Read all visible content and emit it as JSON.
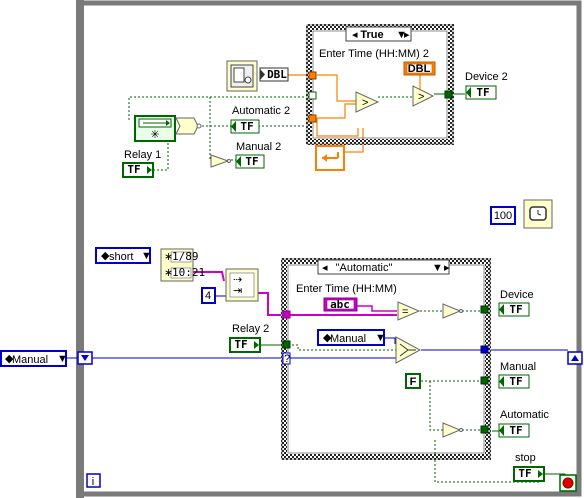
{
  "loop": {
    "info_icon": "i",
    "left_tunnel_control": {
      "value": "Manual",
      "icon": "enum-dropdown-icon"
    }
  },
  "top_case": {
    "selector": "True",
    "local_label": "Enter Time (HH:MM) 2",
    "dbl_constant": "DBL",
    "to_dbl_label": "DBL",
    "output_indicator": {
      "label": "Device 2",
      "tf": "TF"
    }
  },
  "left_top": {
    "relay1": {
      "label": "Relay 1",
      "tf": "TF"
    },
    "automatic2": {
      "label": "Automatic 2",
      "tf": "TF"
    },
    "manual2": {
      "label": "Manual 2",
      "tf": "TF"
    }
  },
  "wait": {
    "ms_constant": "100"
  },
  "lower_left": {
    "format_enum": "short",
    "time_fmt_lines": [
      "1/89",
      "10:21"
    ],
    "numeric_const": "4"
  },
  "bottom_case": {
    "selector": "\"Automatic\"",
    "local_label": "Enter Time (HH:MM)",
    "abc_constant": "abc",
    "relay2": {
      "label": "Relay 2",
      "tf": "TF"
    },
    "enum_const": "Manual",
    "false_const": "F",
    "device": {
      "label": "Device",
      "tf": "TF"
    },
    "manual": {
      "label": "Manual",
      "tf": "TF"
    },
    "automatic": {
      "label": "Automatic",
      "tf": "TF"
    }
  },
  "stop": {
    "label": "stop",
    "tf": "TF"
  },
  "colors": {
    "boolean_wire": "#006600",
    "enum_wire": "#0000cc",
    "string_wire": "#cc00cc",
    "dbl_wire": "#ff8000",
    "loop_frame": "#7a7a7a"
  }
}
